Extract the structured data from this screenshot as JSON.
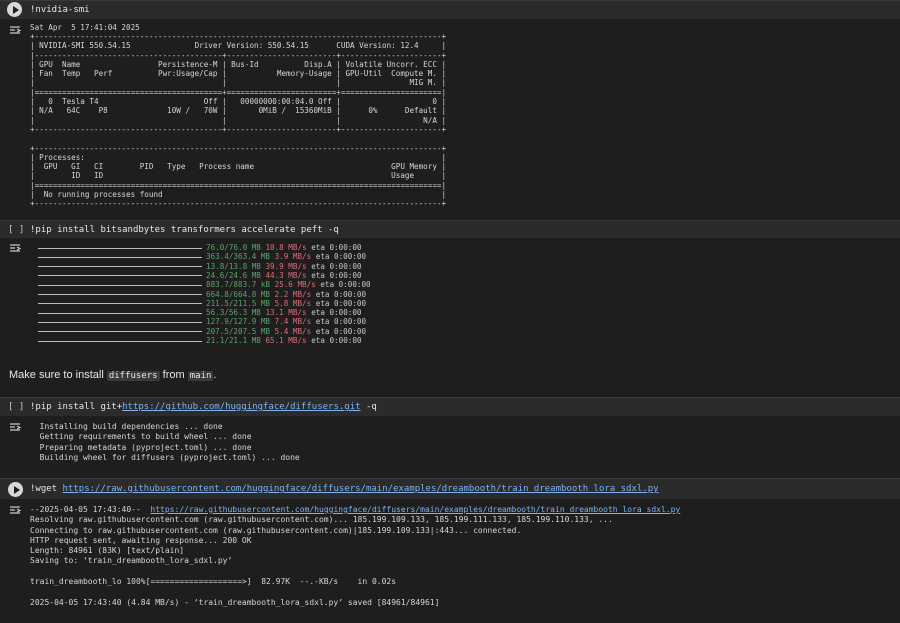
{
  "cells": {
    "c1": {
      "code": "!nvidia-smi"
    },
    "c2": {
      "bracket": "[ ]",
      "code": "!pip install bitsandbytes transformers accelerate peft -q"
    },
    "markdown": {
      "pre": "Make sure to install ",
      "code1": "diffusers",
      "mid": " from ",
      "code2": "main",
      "post": "."
    },
    "c3": {
      "bracket": "[ ]",
      "code_pre": "!pip install git+",
      "code_link": "https://github.com/huggingface/diffusers.git",
      "code_post": " -q"
    },
    "c4": {
      "code_pre": "!wget ",
      "code_link": "https://raw.githubusercontent.com/huggingface/diffusers/main/examples/dreambooth/train_dreambooth_lora_sdxl.py"
    }
  },
  "nvidia_smi": {
    "timestamp": "Sat Apr  5 17:41:04 2025",
    "lines": [
      "+-----------------------------------------------------------------------------------------+",
      "| NVIDIA-SMI 550.54.15              Driver Version: 550.54.15      CUDA Version: 12.4     |",
      "|-----------------------------------------+------------------------+----------------------+",
      "| GPU  Name                 Persistence-M | Bus-Id          Disp.A | Volatile Uncorr. ECC |",
      "| Fan  Temp   Perf          Pwr:Usage/Cap |           Memory-Usage | GPU-Util  Compute M. |",
      "|                                         |                        |               MIG M. |",
      "|=========================================+========================+======================|",
      "|   0  Tesla T4                       Off |   00000000:00:04.0 Off |                    0 |",
      "| N/A   64C    P8             10W /   70W |       0MiB /  15360MiB |      0%      Default |",
      "|                                         |                        |                  N/A |",
      "+-----------------------------------------+------------------------+----------------------+",
      "",
      "+-----------------------------------------------------------------------------------------+",
      "| Processes:                                                                              |",
      "|  GPU   GI   CI        PID   Type   Process name                              GPU Memory |",
      "|        ID   ID                                                               Usage      |",
      "|=========================================================================================|",
      "|  No running processes found                                                             |",
      "+-----------------------------------------------------------------------------------------+"
    ]
  },
  "pip_progress": [
    {
      "size": "76.0/76.0 MB",
      "speed": "10.8 MB/s",
      "eta": "eta 0:00:00"
    },
    {
      "size": "363.4/363.4 MB",
      "speed": "3.9 MB/s",
      "eta": "eta 0:00:00"
    },
    {
      "size": "13.8/13.8 MB",
      "speed": "39.9 MB/s",
      "eta": "eta 0:00:00"
    },
    {
      "size": "24.6/24.6 MB",
      "speed": "44.3 MB/s",
      "eta": "eta 0:00:00"
    },
    {
      "size": "883.7/883.7 kB",
      "speed": "25.6 MB/s",
      "eta": "eta 0:00:00"
    },
    {
      "size": "664.8/664.8 MB",
      "speed": "2.2 MB/s",
      "eta": "eta 0:00:00"
    },
    {
      "size": "211.5/211.5 MB",
      "speed": "5.8 MB/s",
      "eta": "eta 0:00:00"
    },
    {
      "size": "56.3/56.3 MB",
      "speed": "13.1 MB/s",
      "eta": "eta 0:00:00"
    },
    {
      "size": "127.9/127.9 MB",
      "speed": "7.4 MB/s",
      "eta": "eta 0:00:00"
    },
    {
      "size": "207.5/207.5 MB",
      "speed": "5.4 MB/s",
      "eta": "eta 0:00:00"
    },
    {
      "size": "21.1/21.1 MB",
      "speed": "65.1 MB/s",
      "eta": "eta 0:00:00"
    }
  ],
  "diffusers_install": [
    "  Installing build dependencies ... done",
    "  Getting requirements to build wheel ... done",
    "  Preparing metadata (pyproject.toml) ... done",
    "  Building wheel for diffusers (pyproject.toml) ... done"
  ],
  "wget_output": {
    "line1_pre": "--2025-04-05 17:43:40--  ",
    "line1_link": "https://raw.githubusercontent.com/huggingface/diffusers/main/examples/dreambooth/train_dreambooth_lora_sdxl.py",
    "lines": [
      "Resolving raw.githubusercontent.com (raw.githubusercontent.com)... 185.199.109.133, 185.199.111.133, 185.199.110.133, ...",
      "Connecting to raw.githubusercontent.com (raw.githubusercontent.com)|185.199.109.133|:443... connected.",
      "HTTP request sent, awaiting response... 200 OK",
      "Length: 84961 (83K) [text/plain]",
      "Saving to: ‘train_dreambooth_lora_sdxl.py’",
      "",
      "train_dreambooth_lo 100%[===================>]  82.97K  --.-KB/s    in 0.02s",
      "",
      "2025-04-05 17:43:40 (4.84 MB/s) - ‘train_dreambooth_lora_sdxl.py’ saved [84961/84961]"
    ]
  }
}
